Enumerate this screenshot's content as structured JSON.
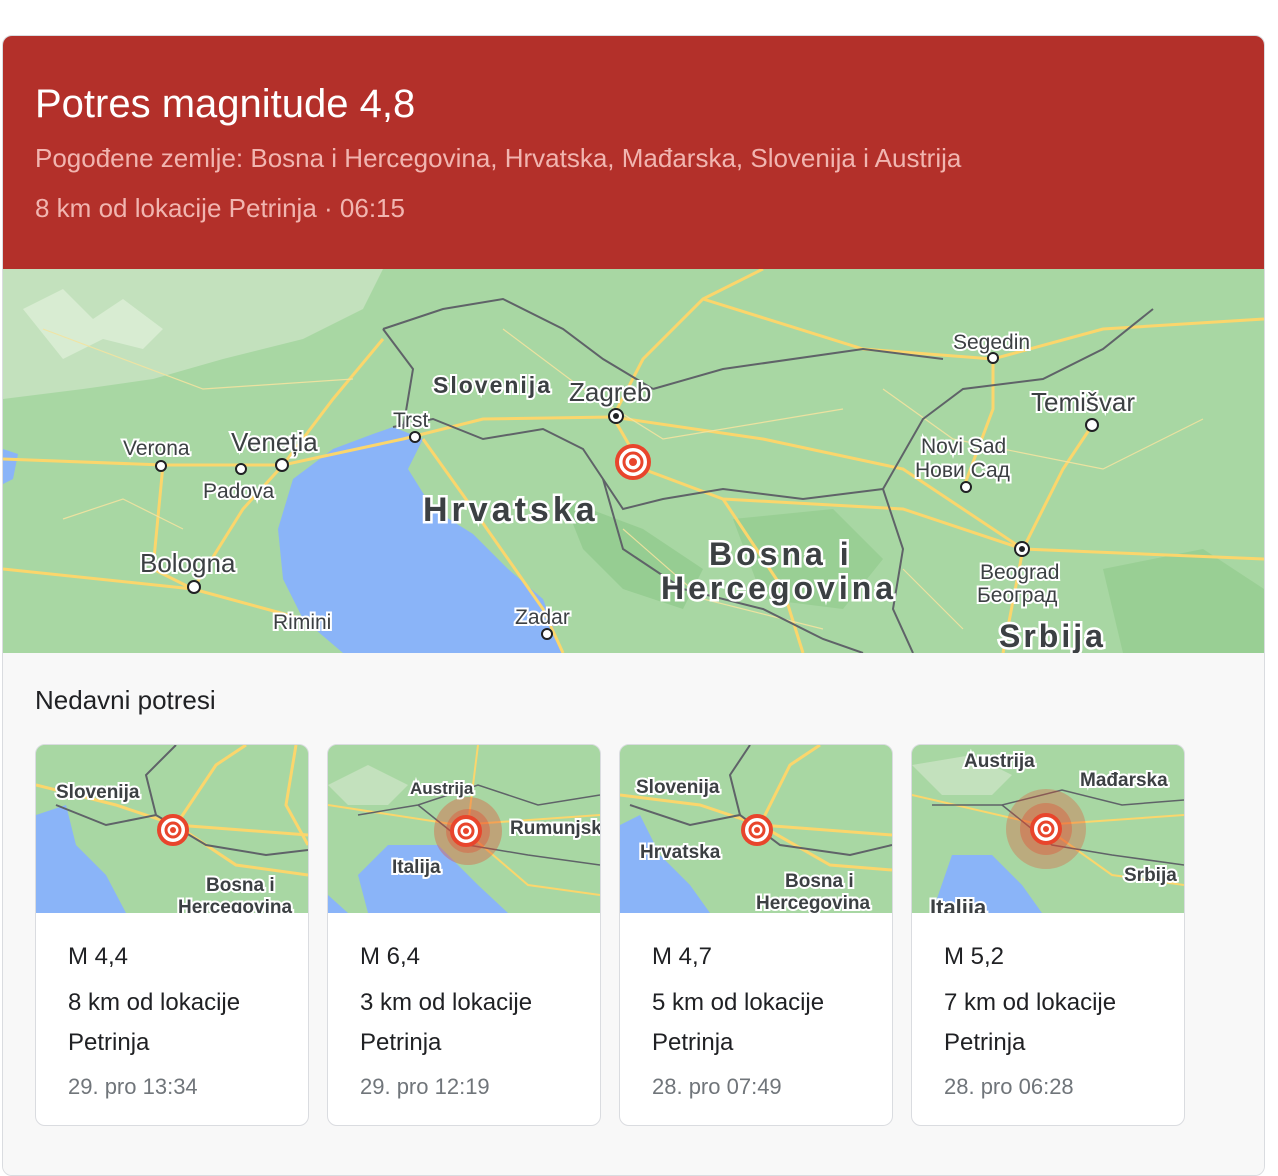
{
  "header": {
    "title": "Potres magnitude 4,8",
    "affected": "Pogođene zemlje: Bosna i Hercegovina, Hrvatska, Mađarska, Slovenija i Austrija",
    "location_time": "8 km od lokacije Petrinja · 06:15"
  },
  "map": {
    "labels": {
      "slovenija": "Slovenija",
      "zagreb": "Zagreb",
      "trst": "Trst",
      "verona": "Verona",
      "venetia": "Veneția",
      "padova": "Padova",
      "hrvatska": "Hrvatska",
      "bologna": "Bologna",
      "rimini": "Rimini",
      "zadar": "Zadar",
      "bosna": "Bosna i",
      "hercegovina": "Hercegovina",
      "segedin": "Segedin",
      "temisvar": "Temišvar",
      "novi_sad": "Novi Sad",
      "novi_sad_cyr": "Нови Сад",
      "beograd": "Beograd",
      "beograd_cyr": "Београд",
      "srbija": "Srbija"
    },
    "colors": {
      "land": "#a8d7a3",
      "sea": "#8ab4f8",
      "road": "#fbd66c",
      "border": "#5f6368",
      "marker": "#e8452c"
    }
  },
  "recent": {
    "title": "Nedavni potresi",
    "items": [
      {
        "magnitude": "M 4,4",
        "distance": "8 km od lokacije Petrinja",
        "time": "29. pro 13:34",
        "map_labels": [
          "Slovenija",
          "Bosna i",
          "Hercegovina"
        ]
      },
      {
        "magnitude": "M 6,4",
        "distance": "3 km od lokacije Petrinja",
        "time": "29. pro 12:19",
        "map_labels": [
          "Austrija",
          "Rumunjsk",
          "Italija"
        ]
      },
      {
        "magnitude": "M 4,7",
        "distance": "5 km od lokacije Petrinja",
        "time": "28. pro 07:49",
        "map_labels": [
          "Slovenija",
          "Hrvatska",
          "Bosna i",
          "Hercegovina"
        ]
      },
      {
        "magnitude": "M 5,2",
        "distance": "7 km od lokacije Petrinja",
        "time": "28. pro 06:28",
        "map_labels": [
          "Austrija",
          "Mađarska",
          "Srbija",
          "Italija"
        ]
      }
    ]
  }
}
